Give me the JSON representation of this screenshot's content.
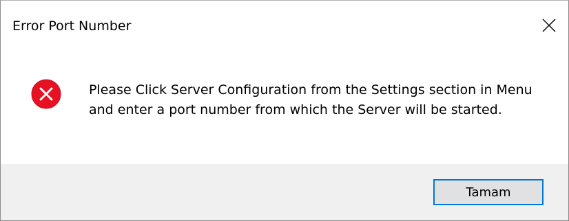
{
  "dialog": {
    "title": "Error Port Number",
    "close_icon": "close-icon",
    "status_icon": "error-icon",
    "message": "Please Click Server Configuration from the Settings section in Menu and enter a port number from which the Server will be started.",
    "ok_label": "Tamam"
  },
  "colors": {
    "error_red": "#e81123",
    "accent": "#0078d7",
    "footer_bg": "#f0f0f0",
    "button_bg": "#e1e1e1"
  }
}
